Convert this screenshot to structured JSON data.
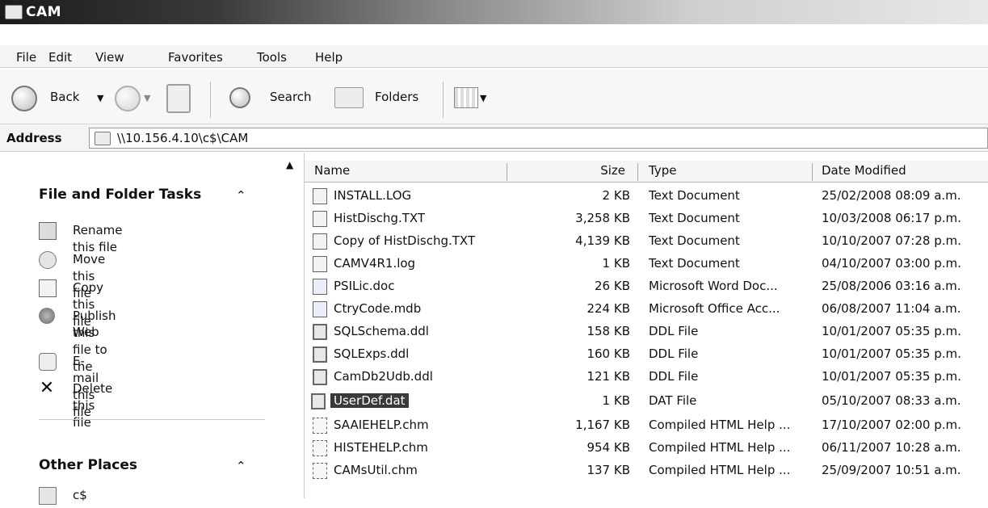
{
  "window": {
    "title": "CAM"
  },
  "menu": [
    "File",
    "Edit",
    "View",
    "Favorites",
    "Tools",
    "Help"
  ],
  "toolbar": {
    "back": "Back",
    "search": "Search",
    "folders": "Folders"
  },
  "address": {
    "label": "Address",
    "path": "\\\\10.156.4.10\\c$\\CAM"
  },
  "tasks": {
    "title": "File and Folder Tasks",
    "items": [
      {
        "label": "Rename this file",
        "icon": "rename-icon"
      },
      {
        "label": "Move this file",
        "icon": "move-icon"
      },
      {
        "label": "Copy this file",
        "icon": "copy-icon"
      },
      {
        "label": "Publish this file to the",
        "label2": "Web",
        "icon": "publish-web-icon"
      },
      {
        "label": "E-mail this file",
        "icon": "email-icon"
      },
      {
        "label": "Delete this file",
        "icon": "delete-icon"
      }
    ]
  },
  "other_places": {
    "title": "Other Places",
    "items": [
      "c$"
    ]
  },
  "columns": {
    "name": "Name",
    "size": "Size",
    "type": "Type",
    "date": "Date Modified"
  },
  "files": [
    {
      "name": "INSTALL.LOG",
      "size": "2 KB",
      "type": "Text Document",
      "date": "25/02/2008 08:09 a.m."
    },
    {
      "name": "HistDischg.TXT",
      "size": "3,258 KB",
      "type": "Text Document",
      "date": "10/03/2008 06:17 p.m."
    },
    {
      "name": "Copy of HistDischg.TXT",
      "size": "4,139 KB",
      "type": "Text Document",
      "date": "10/10/2007 07:28 p.m."
    },
    {
      "name": "CAMV4R1.log",
      "size": "1 KB",
      "type": "Text Document",
      "date": "04/10/2007 03:00 p.m."
    },
    {
      "name": "PSILic.doc",
      "size": "26 KB",
      "type": "Microsoft Word Doc...",
      "date": "25/08/2006 03:16 a.m."
    },
    {
      "name": "CtryCode.mdb",
      "size": "224 KB",
      "type": "Microsoft Office Acc...",
      "date": "06/08/2007 11:04 a.m."
    },
    {
      "name": "SQLSchema.ddl",
      "size": "158 KB",
      "type": "DDL File",
      "date": "10/01/2007 05:35 p.m."
    },
    {
      "name": "SQLExps.ddl",
      "size": "160 KB",
      "type": "DDL File",
      "date": "10/01/2007 05:35 p.m."
    },
    {
      "name": "CamDb2Udb.ddl",
      "size": "121 KB",
      "type": "DDL File",
      "date": "10/01/2007 05:35 p.m."
    },
    {
      "name": "UserDef.dat",
      "size": "1 KB",
      "type": "DAT File",
      "date": "05/10/2007 08:33 a.m.",
      "selected": true
    },
    {
      "name": "SAAIEHELP.chm",
      "size": "1,167 KB",
      "type": "Compiled HTML Help ...",
      "date": "17/10/2007 02:00 p.m."
    },
    {
      "name": "HISTEHELP.chm",
      "size": "954 KB",
      "type": "Compiled HTML Help ...",
      "date": "06/11/2007 10:28 a.m."
    },
    {
      "name": "CAMsUtil.chm",
      "size": "137 KB",
      "type": "Compiled HTML Help ...",
      "date": "25/09/2007 10:51 a.m."
    }
  ]
}
